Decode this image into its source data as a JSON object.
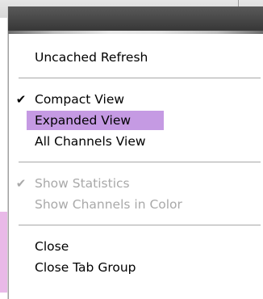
{
  "menu": {
    "items": [
      {
        "label": "Uncached Refresh",
        "checked": false,
        "enabled": true,
        "highlighted": false
      },
      {
        "label": "Compact View",
        "checked": true,
        "enabled": true,
        "highlighted": false
      },
      {
        "label": "Expanded View",
        "checked": false,
        "enabled": true,
        "highlighted": true
      },
      {
        "label": "All Channels View",
        "checked": false,
        "enabled": true,
        "highlighted": false
      },
      {
        "label": "Show Statistics",
        "checked": true,
        "enabled": false,
        "highlighted": false
      },
      {
        "label": "Show Channels in Color",
        "checked": false,
        "enabled": false,
        "highlighted": false
      },
      {
        "label": "Close",
        "checked": false,
        "enabled": true,
        "highlighted": false
      },
      {
        "label": "Close Tab Group",
        "checked": false,
        "enabled": true,
        "highlighted": false
      }
    ],
    "check_glyph": "✔",
    "colors": {
      "highlight": "#c59ae3",
      "disabled_text": "#a9a9a9",
      "header": "#444444"
    }
  }
}
